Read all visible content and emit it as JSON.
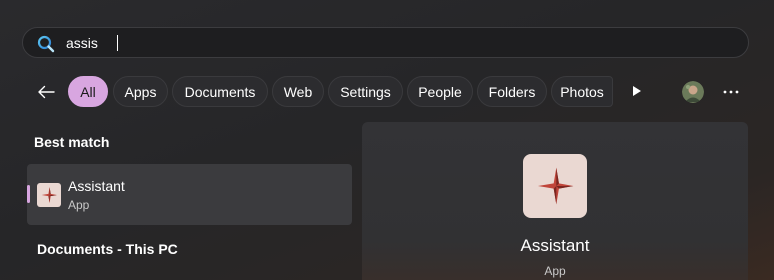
{
  "search": {
    "query": "assis",
    "icon": "search-icon"
  },
  "filters": {
    "back_icon": "back-arrow-icon",
    "chips": [
      {
        "label": "All",
        "active": true
      },
      {
        "label": "Apps"
      },
      {
        "label": "Documents"
      },
      {
        "label": "Web"
      },
      {
        "label": "Settings"
      },
      {
        "label": "People"
      },
      {
        "label": "Folders"
      },
      {
        "label": "Photos"
      }
    ],
    "play_icon": "play-icon",
    "avatar_icon": "user-avatar",
    "more_icon": "more-icon"
  },
  "results": {
    "best_match_header": "Best match",
    "best_match": {
      "name": "Assistant",
      "type": "App",
      "icon": "assistant-app-icon"
    },
    "documents_header": "Documents - This PC"
  },
  "preview": {
    "name": "Assistant",
    "type": "App",
    "icon": "assistant-app-icon"
  },
  "colors": {
    "accent": "#d8a6e0",
    "icon_bg": "#ead8d2",
    "star_dark": "#8a2c24",
    "star_light": "#c0453a"
  }
}
